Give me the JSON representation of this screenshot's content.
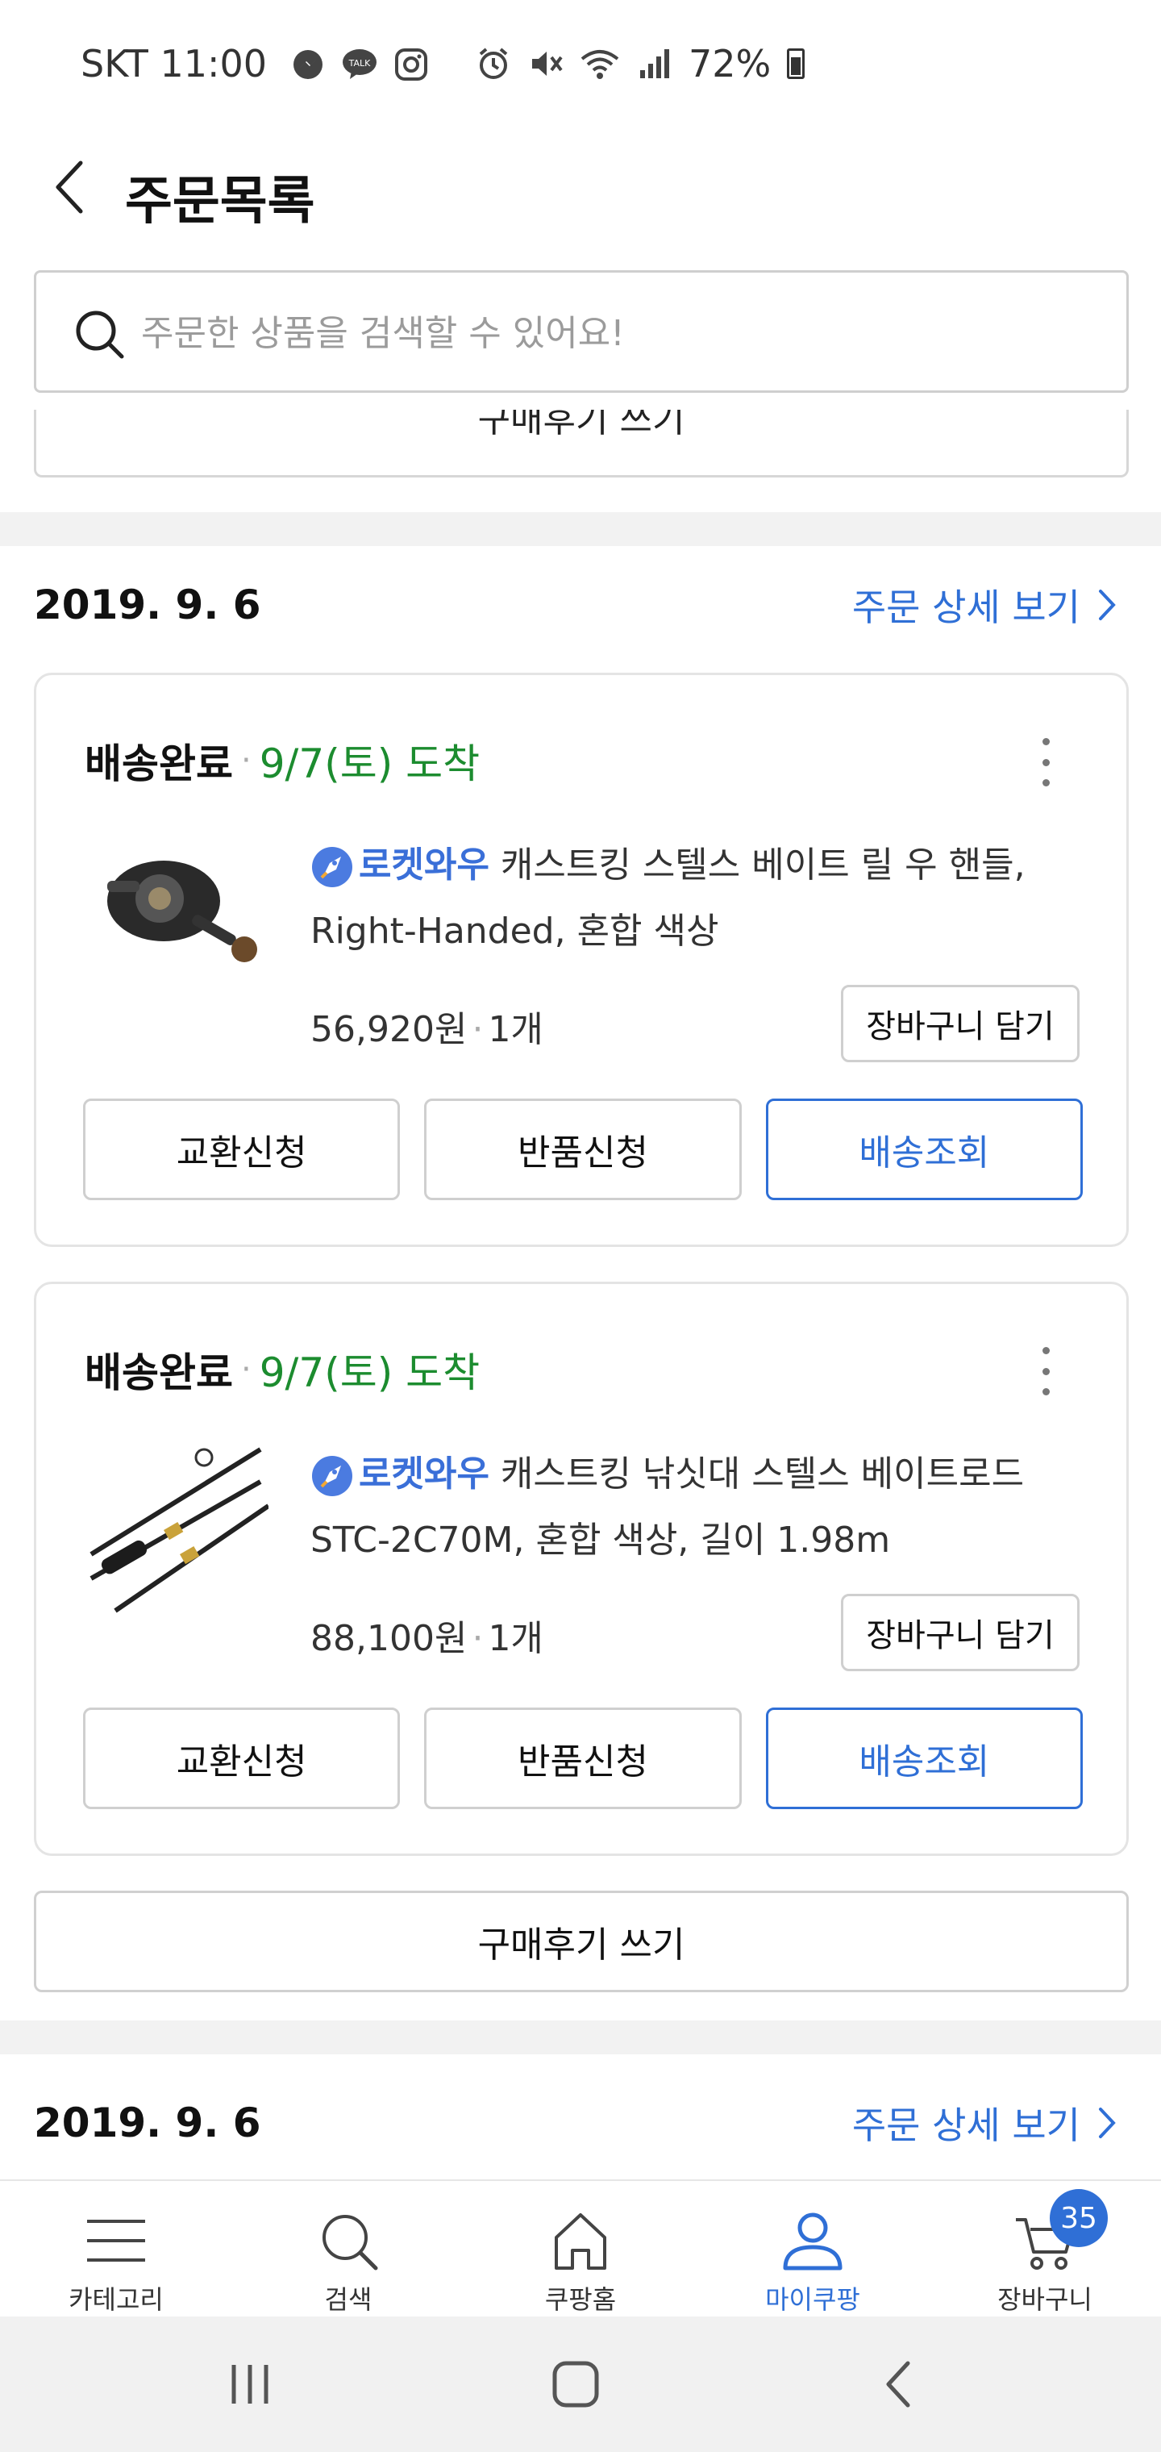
{
  "status_bar": {
    "carrier_time": "SKT 11:00",
    "battery": "72%",
    "app_icons": [
      "messenger-icon",
      "kakaotalk-icon",
      "instagram-icon"
    ],
    "system_icons": [
      "alarm-icon",
      "mute-icon",
      "wifi-icon",
      "signal-icon",
      "battery-icon"
    ]
  },
  "header": {
    "title": "주문목록"
  },
  "search": {
    "placeholder": "주문한 상품을 검색할 수 있어요!"
  },
  "partial_review_label": "구매후기 쓰기",
  "orders": [
    {
      "date": "2019. 9. 6",
      "detail_link": "주문 상세 보기",
      "items": [
        {
          "status": "배송완료",
          "arrival": "9/7(토) 도착",
          "rocket_label": "로켓와우",
          "product_name": "캐스트킹 스텔스 베이트 릴 우 핸들, Right-Handed, 혼합 색상",
          "price": "56,920원",
          "qty": "1개",
          "cart_label": "장바구니 담기",
          "actions": [
            "교환신청",
            "반품신청",
            "배송조회"
          ]
        },
        {
          "status": "배송완료",
          "arrival": "9/7(토) 도착",
          "rocket_label": "로켓와우",
          "product_name": "캐스트킹 낚싯대 스텔스 베이트로드 STC-2C70M, 혼합 색상, 길이 1.98m",
          "price": "88,100원",
          "qty": "1개",
          "cart_label": "장바구니 담기",
          "actions": [
            "교환신청",
            "반품신청",
            "배송조회"
          ]
        }
      ],
      "review_label": "구매후기 쓰기"
    },
    {
      "date": "2019. 9. 6",
      "detail_link": "주문 상세 보기"
    }
  ],
  "bottom_nav": {
    "items": [
      {
        "label": "카테고리",
        "icon": "menu-icon"
      },
      {
        "label": "검색",
        "icon": "search-icon"
      },
      {
        "label": "쿠팡홈",
        "icon": "home-icon"
      },
      {
        "label": "마이쿠팡",
        "icon": "user-icon",
        "active": true
      },
      {
        "label": "장바구니",
        "icon": "cart-icon"
      }
    ],
    "cart_badge": "35"
  },
  "colors": {
    "accent": "#2f6fd6",
    "arrival_green": "#1c8c2f"
  }
}
